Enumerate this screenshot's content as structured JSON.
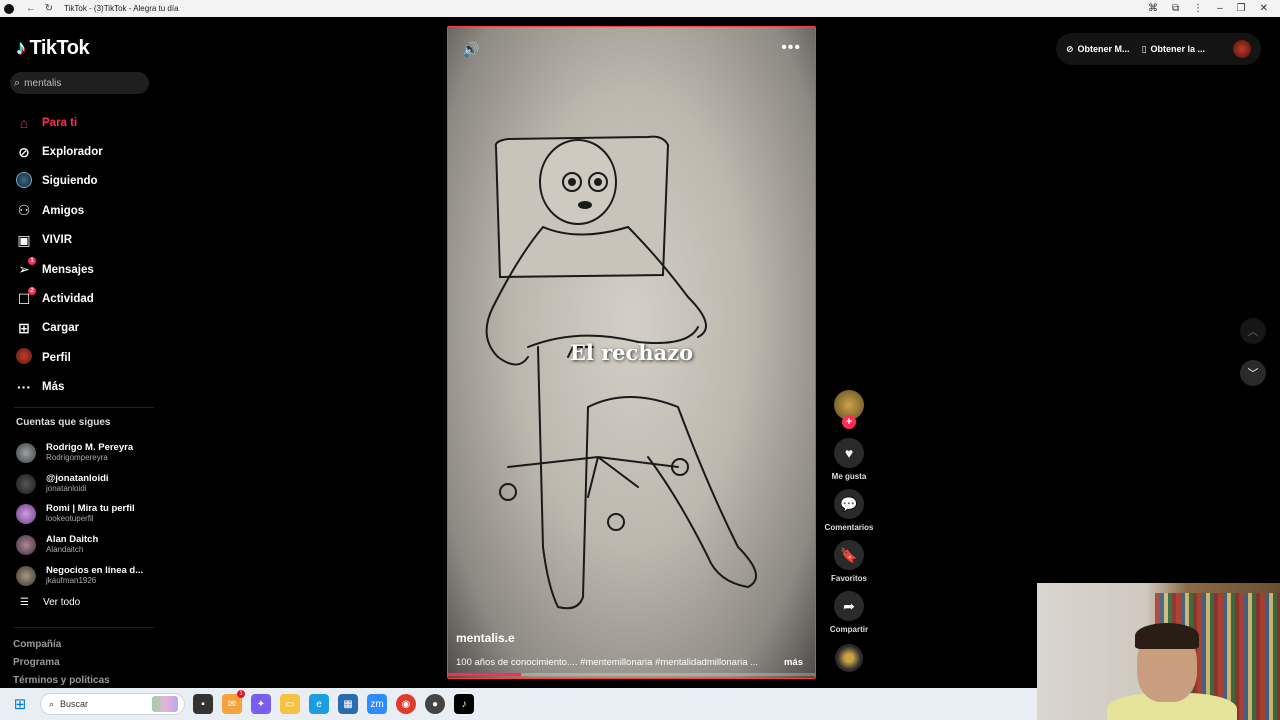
{
  "browser": {
    "title": "TikTok - (3)TikTok - Alegra tu día",
    "back_icon": "arrow-left-icon",
    "refresh_icon": "refresh-icon"
  },
  "sidebar": {
    "logo_text": "TikTok",
    "search_value": "mentalis",
    "nav": [
      {
        "label": "Para ti",
        "icon": "home-icon",
        "active": true
      },
      {
        "label": "Explorador",
        "icon": "compass-icon"
      },
      {
        "label": "Siguiendo",
        "icon": "following-icon"
      },
      {
        "label": "Amigos",
        "icon": "friends-icon"
      },
      {
        "label": "VIVIR",
        "icon": "live-icon"
      },
      {
        "label": "Mensajes",
        "icon": "messages-icon",
        "badge": "1"
      },
      {
        "label": "Actividad",
        "icon": "activity-icon",
        "badge": "2"
      },
      {
        "label": "Cargar",
        "icon": "upload-icon"
      },
      {
        "label": "Perfil",
        "icon": "profile-icon"
      },
      {
        "label": "Más",
        "icon": "more-icon"
      }
    ],
    "following_title": "Cuentas que sigues",
    "following": [
      {
        "name": "Rodrigo M. Pereyra",
        "handle": "Rodrigompereyra"
      },
      {
        "name": "@jonatanloidi",
        "handle": "jonatanloidi"
      },
      {
        "name": "Romi | Mira tu perfil",
        "handle": "lookeotuperfil"
      },
      {
        "name": "Alan Daitch",
        "handle": "Alandaitch"
      },
      {
        "name": "Negocios en línea d...",
        "handle": "jkaufman1926"
      }
    ],
    "see_all": "Ver todo",
    "footer": [
      "Compañía",
      "Programa",
      "Términos y políticas"
    ]
  },
  "video": {
    "overlay_text": "El rechazo",
    "author": "mentalis.e",
    "description": "100 años de conocimiento.... #mentemillonaria #mentalidadmillonaria ...",
    "more_label": "más",
    "progress": 0.2
  },
  "actions": {
    "like": "Me gusta",
    "comments": "Comentarios",
    "favorites": "Favoritos",
    "share": "Compartir"
  },
  "topbar": {
    "get_coins": "Obtener M...",
    "get_app": "Obtener la ..."
  },
  "taskbar": {
    "search_placeholder": "Buscar",
    "notif_badge": "1"
  },
  "colors": {
    "accent": "#fe2c55",
    "background": "#000000"
  }
}
